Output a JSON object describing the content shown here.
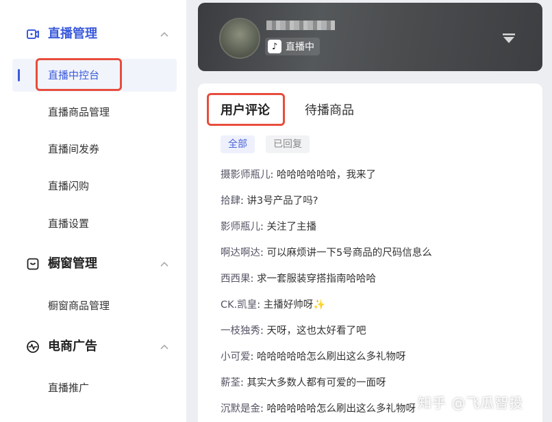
{
  "sidebar": {
    "groups": [
      {
        "title": "直播管理",
        "icon": "live-camera-icon",
        "items": [
          "直播中控台",
          "直播商品管理",
          "直播间发券",
          "直播闪购",
          "直播设置"
        ]
      },
      {
        "title": "橱窗管理",
        "icon": "showcase-icon",
        "items": [
          "橱窗商品管理"
        ]
      },
      {
        "title": "电商广告",
        "icon": "pulse-icon",
        "items": [
          "直播推广"
        ]
      }
    ],
    "active_item": "直播中控台"
  },
  "live_header": {
    "status_label": "直播中",
    "platform_icon": "tiktok-icon"
  },
  "panel": {
    "tabs": [
      "用户评论",
      "待播商品"
    ],
    "active_tab": "用户评论",
    "filters": [
      "全部",
      "已回复"
    ],
    "active_filter": "全部",
    "comments": [
      {
        "user": "摄影师瓶儿",
        "text": "哈哈哈哈哈哈，我来了"
      },
      {
        "user": "拾肆",
        "text": "讲3号产品了吗?"
      },
      {
        "user": "影师瓶儿",
        "text": "关注了主播"
      },
      {
        "user": "啊达啊达",
        "text": "可以麻烦讲一下5号商品的尺码信息么"
      },
      {
        "user": "西西果",
        "text": "求一套服装穿搭指南哈哈哈"
      },
      {
        "user": "CK.凯皇",
        "text": "主播好帅呀",
        "emoji": "✨"
      },
      {
        "user": "一枝独秀",
        "text": "天呀，这也太好看了吧"
      },
      {
        "user": "小可爱",
        "text": "哈哈哈哈哈怎么刷出这么多礼物呀"
      },
      {
        "user": "薪荃",
        "text": "其实大多数人都有可爱的一面呀"
      },
      {
        "user": "沉默是金",
        "text": "哈哈哈哈哈怎么刷出这么多礼物呀"
      }
    ]
  },
  "watermark": "知乎 @飞瓜智投",
  "colors": {
    "highlight": "#e74c3c",
    "accent": "#3b5bdb"
  }
}
